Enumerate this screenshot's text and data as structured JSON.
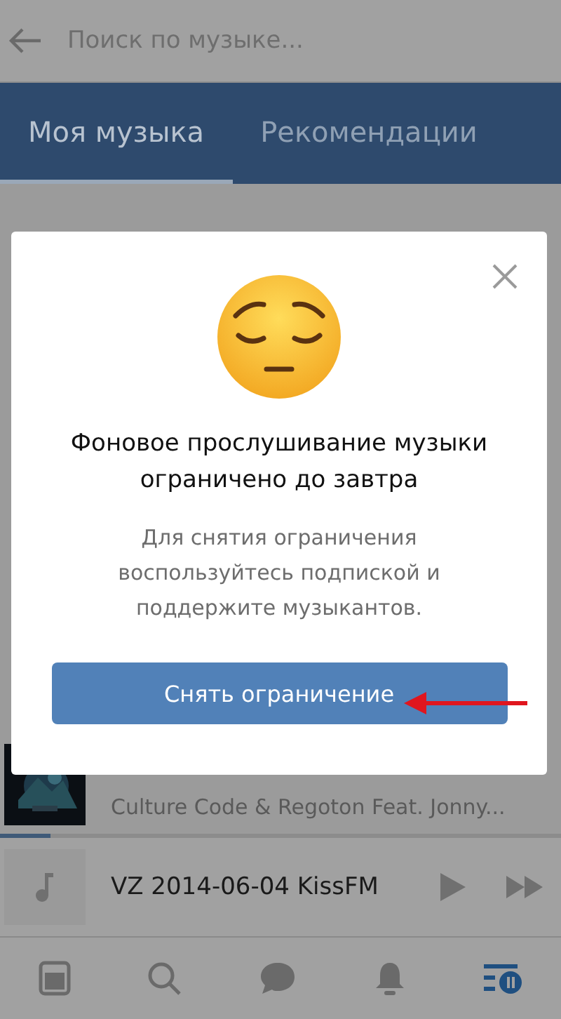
{
  "search": {
    "placeholder": "Поиск по музыке..."
  },
  "tabs": [
    {
      "label": "Моя музыка",
      "selected": true
    },
    {
      "label": "Рекомендации",
      "selected": false
    }
  ],
  "tracks": [
    {
      "title": "Culture Code & Regoton Feat. Jonny..."
    }
  ],
  "player": {
    "title": "VZ 2014-06-04 KissFM",
    "level": 0.09
  },
  "nav": [
    {
      "kind": "news",
      "selected": false
    },
    {
      "kind": "search",
      "selected": false
    },
    {
      "kind": "messages",
      "selected": false
    },
    {
      "kind": "notifications",
      "selected": false
    },
    {
      "kind": "music",
      "selected": true
    }
  ],
  "dialog": {
    "heading": "Фоновое прослушивание музыки ограничено до завтра",
    "message": "Для снятия ограничения воспользуйтесь подпиской и поддержите музыкантов.",
    "button": "Снять ограничение"
  }
}
